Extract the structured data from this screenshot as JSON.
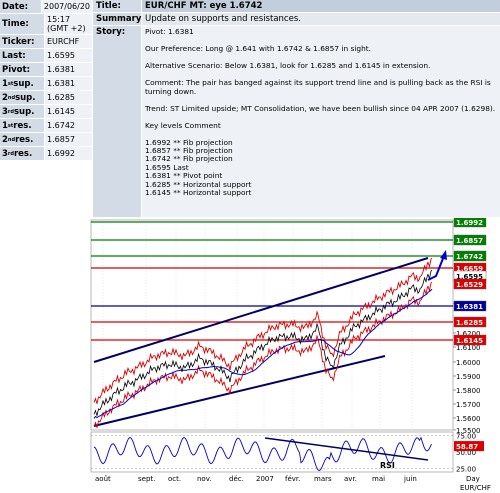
{
  "left": {
    "date_label": "Date:",
    "date_value": "2007/06/20",
    "time_label": "Time:",
    "time_value": "15:17",
    "time_zone": "(GMT +2)",
    "ticker_label": "Ticker:",
    "ticker_value": "EURCHF",
    "last_label": "Last:",
    "last_value": "1.6595",
    "pivot_label": "Pivot:",
    "pivot_value": "1.6381",
    "s1_num": "1",
    "s1_sup": "st",
    "s1_rest": " sup.",
    "s1_value": "1.6381",
    "s2_num": "2",
    "s2_sup": "nd",
    "s2_rest": " sup.",
    "s2_value": "1.6285",
    "s3_num": "3",
    "s3_sup": "rd",
    "s3_rest": " sup.",
    "s3_value": "1.6145",
    "r1_num": "1",
    "r1_sup": "st",
    "r1_rest": " res.",
    "r1_value": "1.6742",
    "r2_num": "2",
    "r2_sup": "nd",
    "r2_rest": " res.",
    "r2_value": "1.6857",
    "r3_num": "3",
    "r3_sup": "rd",
    "r3_rest": " res.",
    "r3_value": "1.6992"
  },
  "header": {
    "title_label": "Title:",
    "title_value": "EUR/CHF MT: eye 1.6742",
    "summary_label": "Summary:",
    "summary_value": "Update on supports and resistances.",
    "story_label": "Story:"
  },
  "story": {
    "pivot": "Pivot: 1.6381",
    "preference": "Our Preference: Long @ 1.641 with 1.6742 & 1.6857 in sight.",
    "alternative": "Alternative Scenario: Below 1.6381, look for 1.6285 and 1.6145 in extension.",
    "comment": "Comment: The pair has banged against its support trend line and is pulling back as the RSI is turning down.",
    "trend": "Trend: ST Limited upside; MT Consolidation, we have been bullish since 04 APR 2007 (1.6298).",
    "key_levels_header": "Key levels Comment",
    "levels": [
      "1.6992 ** Fib projection",
      "1.6857 ** Fib projection",
      "1.6742 ** Fib projection",
      "1.6595 Last",
      "1.6381 ** Pivot point",
      "1.6285 ** Horizontal support",
      "1.6145 ** Horizontal support"
    ]
  },
  "chart_data": {
    "type": "line",
    "price_axis": {
      "ticks": [
        "1.6400",
        "1.6200",
        "1.6100",
        "1.6000",
        "1.5900",
        "1.5800",
        "1.5700",
        "1.5600",
        "1.5500"
      ],
      "tick_values": [
        1.64,
        1.62,
        1.61,
        1.6,
        1.59,
        1.58,
        1.57,
        1.56,
        1.55
      ],
      "ylim": [
        1.545,
        1.7
      ]
    },
    "horizontal_levels": [
      {
        "value": 1.6992,
        "label": "1.6992",
        "color": "#007a00",
        "label_bg": "#008000"
      },
      {
        "value": 1.6857,
        "label": "1.6857",
        "color": "#007a00",
        "label_bg": "#008000"
      },
      {
        "value": 1.6742,
        "label": "1.6742",
        "color": "#007a00",
        "label_bg": "#008000"
      },
      {
        "value": 1.6659,
        "label": "1.6659",
        "color": "#cc0000",
        "label_bg": "#dd0000"
      },
      {
        "value": 1.6595,
        "label": "1.6595",
        "color": "none",
        "label_bg": "#ffffff",
        "label_fg": "#000000"
      },
      {
        "value": 1.6529,
        "label": "1.6529",
        "color": "none",
        "label_bg": "#dd0000"
      },
      {
        "value": 1.6381,
        "label": "1.6381",
        "color": "#000099",
        "label_bg": "#000099"
      },
      {
        "value": 1.6285,
        "label": "1.6285",
        "color": "#dd0000",
        "label_bg": "#dd0000"
      },
      {
        "value": 1.6145,
        "label": "1.6145",
        "color": "#dd0000",
        "label_bg": "#dd0000"
      }
    ],
    "x_labels": [
      "août",
      "sept.",
      "oct.",
      "nov.",
      "déc.",
      "2007",
      "févr.",
      "mars",
      "avr.",
      "mai",
      "juin"
    ],
    "x_label_right": "Day",
    "symbol_label": "EUR/CHF",
    "rsi": {
      "label": "RSI",
      "ticks": [
        "75.00",
        "50.00",
        "25.00"
      ],
      "current": "58.87",
      "current_bg": "#dd0000"
    },
    "colors": {
      "price": "#000000",
      "bands": "#dd0000",
      "ma": "#0000cc",
      "channel": "#000066",
      "arrow": "#0000cc"
    }
  }
}
